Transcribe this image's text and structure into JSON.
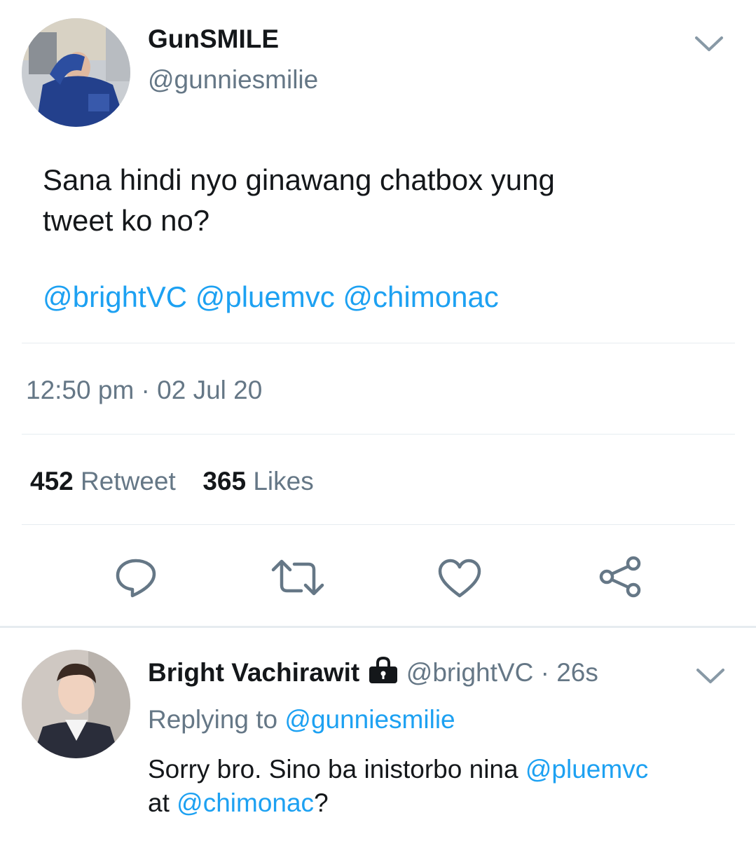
{
  "tweet": {
    "author_name": "GunSMILE",
    "author_handle": "@gunniesmilie",
    "text_line1": "Sana hindi nyo ginawang chatbox yung",
    "text_line2": "tweet ko no?",
    "mentions": [
      "@brightVC",
      "@pluemvc",
      "@chimonac"
    ],
    "timestamp": "12:50 pm · 02 Jul 20",
    "retweet_count": "452",
    "retweet_label": "Retweet",
    "like_count": "365",
    "like_label": "Likes"
  },
  "actions": {
    "icons": [
      "reply-icon",
      "retweet-icon",
      "like-icon",
      "share-icon"
    ]
  },
  "reply": {
    "author_name": "Bright Vachirawit",
    "protected_icon": "lock-icon",
    "author_handle": "@brightVC",
    "time_sep": "·",
    "time": "26s",
    "replying_prefix": "Replying to",
    "replying_handle": "@gunniesmilie",
    "text_part1": "Sorry bro. Sino ba inistorbo nina",
    "mention1": "@pluemvc",
    "text_part2": "at",
    "mention2": "@chimonac",
    "text_end": "?"
  },
  "colors": {
    "link": "#1da1f2",
    "muted": "#657786",
    "text": "#14171a",
    "divider": "#e6ecf0"
  }
}
